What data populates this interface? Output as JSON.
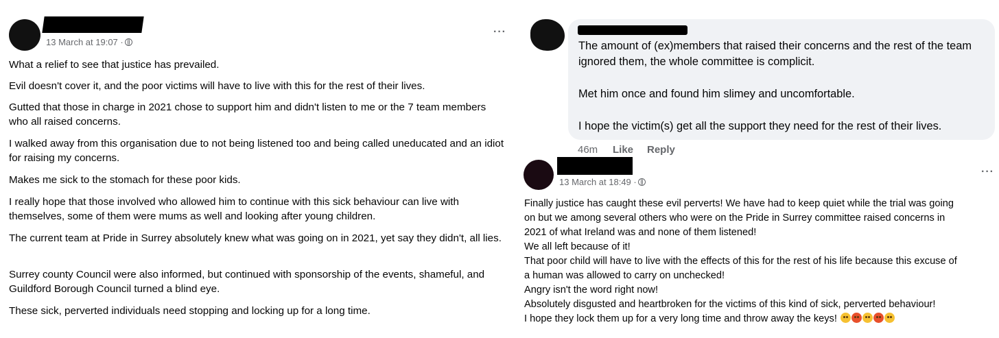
{
  "post_left": {
    "timestamp": "13 March at 19:07 ·",
    "more_label": "···",
    "paragraphs": [
      "What a relief to see that justice has prevailed.",
      "Evil doesn't cover it, and the poor victims will have to live with this for the rest of their lives.",
      "Gutted that those in charge in 2021 chose to support him and didn't listen to me or the 7 team members who all raised concerns.",
      "I walked away from this organisation due to not being listened too and being called uneducated and an idiot for raising my concerns.",
      "Makes me sick to the stomach for these poor kids.",
      "I really hope that those involved who allowed him to continue with this sick behaviour can live with themselves, some of them were mums as well and looking after young children.",
      "The current team at Pride in Surrey absolutely knew what was going on in 2021, yet say they didn't, all lies.",
      "Surrey county Council were also informed, but continued with sponsorship of the events, shameful, and Guildford Borough Council turned a blind eye.",
      "These sick, perverted individuals need stopping and locking up for a long time."
    ]
  },
  "comment": {
    "paragraphs": [
      "The amount of (ex)members that raised their concerns and the rest of the team ignored them, the whole committee is complicit.",
      "Met him once and found him slimey and uncomfortable.",
      "I hope the victim(s) get all the support they need for the rest of their lives."
    ],
    "age": "46m",
    "like_label": "Like",
    "reply_label": "Reply"
  },
  "post_right": {
    "timestamp": "13 March at 18:49 ·",
    "more_label": "···",
    "lines": [
      "Finally justice has caught these evil perverts! We have had to keep quiet while the trial was going",
      "on but we among several others who were on the Pride in Surrey committee raised concerns in",
      "2021 of what Ireland was and none of them listened!",
      "We all left because of it!",
      "That poor child will have to live with the effects of this for the rest of his life because this excuse of",
      "a human was allowed to carry on unchecked!",
      "Angry isn't the word right now!",
      "Absolutely disgusted and heartbroken for the victims of this kind of sick, perverted behaviour!",
      "I hope they lock them up for a very long time and throw away the keys!"
    ],
    "emojis": [
      "crying-face-icon",
      "angry-face-icon",
      "crying-face-icon",
      "angry-face-icon",
      "crying-face-icon"
    ]
  }
}
